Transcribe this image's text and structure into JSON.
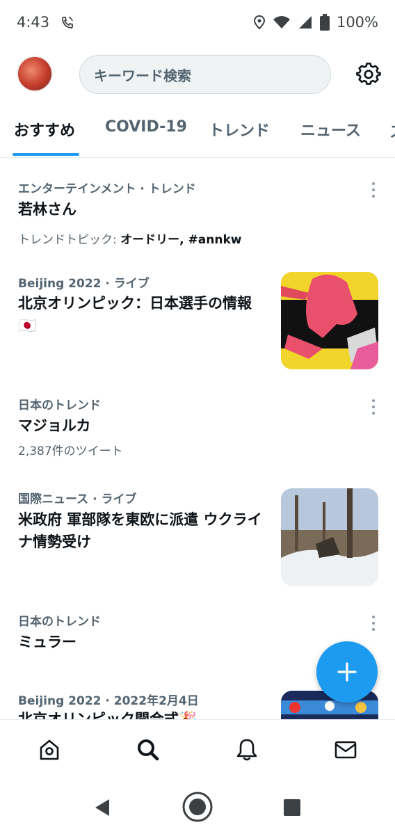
{
  "status_bar": {
    "time": "4:43",
    "battery": "100%"
  },
  "header": {
    "search_placeholder": "キーワード検索"
  },
  "tabs": [
    {
      "label": "おすすめ"
    },
    {
      "label": "COVID-19"
    },
    {
      "label": "トレンド"
    },
    {
      "label": "ニュース"
    }
  ],
  "feed": {
    "item1": {
      "meta": "エンターテインメント · トレンド",
      "headline": "若林さん",
      "topic_prefix": "トレンドトピック:",
      "topic_value": "オードリー, #annkw"
    },
    "item2": {
      "meta": "Beijing 2022 · ライブ",
      "headline": "北京オリンピック：日本選手の情報🇯🇵"
    },
    "item3": {
      "meta": "日本のトレンド",
      "headline": "マジョルカ",
      "count": "2,387件のツイート"
    },
    "item4": {
      "meta": "国際ニュース · ライブ",
      "headline": "米政府 軍部隊を東欧に派遣 ウクライナ情勢受け"
    },
    "item5": {
      "meta": "日本のトレンド",
      "headline": "ミュラー"
    },
    "item6": {
      "meta": "Beijing 2022 · 2022年2月4日",
      "headline": "北京オリンピック開会式🎉"
    }
  },
  "colors": {
    "accent": "#1d9bf0",
    "text_primary": "#0f1419",
    "text_secondary": "#536471"
  }
}
